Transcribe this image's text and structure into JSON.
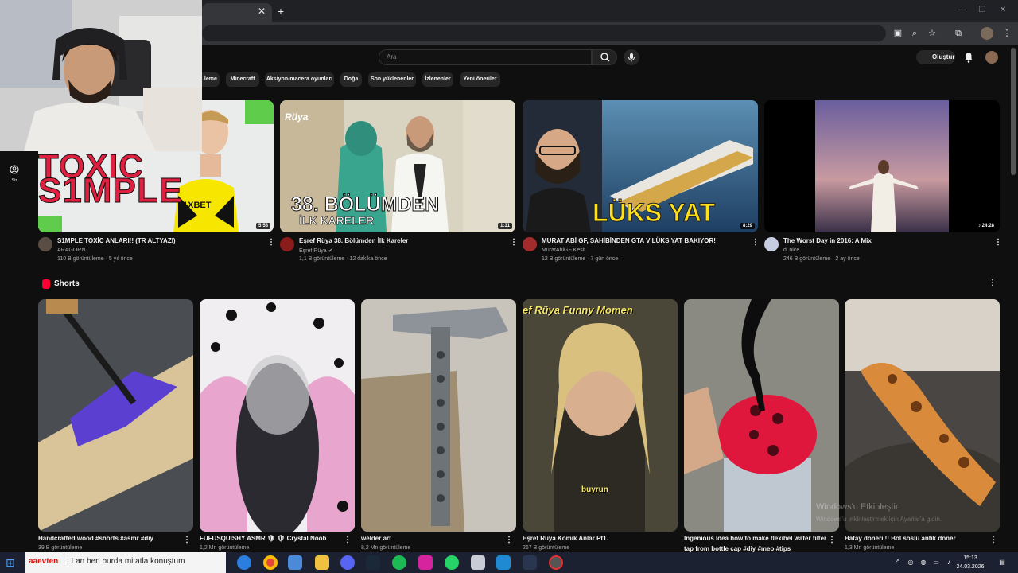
{
  "youtube": {
    "search_placeholder": "Ara",
    "create_label": "Oluştur",
    "side_you_label": "Siz",
    "chips": [
      "...leme",
      "Minecraft",
      "Aksiyon-macera oyunları",
      "Doğa",
      "Son yüklenenler",
      "İzlenenler",
      "Yeni öneriler"
    ],
    "videos": [
      {
        "title": "S1MPLE TOXİC ANLARI!! (TR ALTYAZI)",
        "channel": "ARAGORN",
        "meta": "110 B görüntüleme · 5 yıl önce",
        "duration": "5:58",
        "thumb_text": "S1MPLE",
        "thumb_text2": "TOXIC",
        "shirt_text": "1XBET"
      },
      {
        "title": "Eşref Rüya 38. Bölümden İlk Kareler",
        "channel": "Eşref Rüya",
        "meta": "1,1 B görüntüleme · 12 dakika önce",
        "duration": "1:31",
        "thumb_text": "38. BÖLÜMDEN",
        "thumb_text2": "İLK KARELER",
        "logo_text": "Rüya"
      },
      {
        "title": "MURAT ABİ GF, SAHİBİNDEN GTA V LÜKS YAT BAKIYOR!",
        "channel": "MuratAbiGF Kesit",
        "meta": "12 B görüntüleme · 7 gün önce",
        "duration": "8:29",
        "thumb_text": "LÜKS YAT"
      },
      {
        "title": "The Worst Day in 2016: A Mix",
        "channel": "dj nice",
        "meta": "246 B görüntüleme · 2 ay önce",
        "duration": "24:28"
      }
    ],
    "shorts_title": "Shorts",
    "shorts": [
      {
        "title": "Handcrafted wood #shorts #asmr #diy",
        "meta": "39 B görüntüleme"
      },
      {
        "title": "FUFUSQUISHY ASMR 🛡 🛡 Crystal Noob",
        "meta": "1,2 Mn görüntüleme"
      },
      {
        "title": "welder art",
        "meta": "8,2 Mn görüntüleme"
      },
      {
        "title": "Eşref Rüya Komik Anlar Pt1.",
        "meta": "267 B görüntüleme",
        "overlay": "ef Rüya Funny Momen",
        "caption": "buyrun"
      },
      {
        "title": "Ingenious Idea how to make flexibel water filter",
        "title2": "tap from bottle cap #diy #meo #tips",
        "meta": ""
      },
      {
        "title": "Hatay döneri !! Bol soslu antik döner",
        "meta": "1,3 Mn görüntüleme"
      }
    ]
  },
  "watermark": {
    "line1": "Windows'u Etkinleştir",
    "line2": "Windows'u etkinleştirmek için Ayarlar'a gidin."
  },
  "chat": {
    "user": "aaevten",
    "message": ": Lan ben burda mitatla konuştum"
  },
  "clock": {
    "time": "15:13",
    "date": "24.03.2026"
  },
  "colors": {
    "bg": "#0f0f0f",
    "chip": "#272727",
    "brand_red": "#ff0033",
    "taskbar": "#1b2130"
  }
}
